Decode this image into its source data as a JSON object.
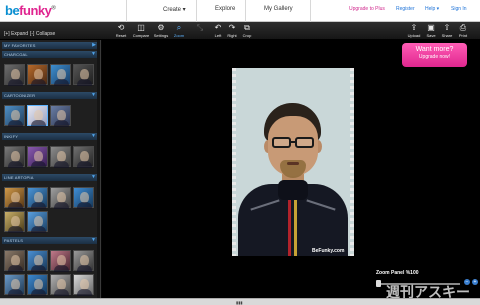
{
  "app": {
    "logo_be": "be",
    "logo_funky": "funky",
    "logo_mark": "®"
  },
  "topnav": {
    "create": "Create ▾",
    "explore": "Explore",
    "gallery": "My Gallery",
    "upgrade": "Upgrade to Plus",
    "register": "Register",
    "help": "Help ▾",
    "signin": "Sign In"
  },
  "toolbar": {
    "expand": "[+] Expand",
    "collapse": "[-] Collapse",
    "tools": [
      {
        "label": "Reset",
        "icon": "⟲"
      },
      {
        "label": "Compare",
        "icon": "◫"
      },
      {
        "label": "Settings",
        "icon": "⚙"
      },
      {
        "label": "Zoom",
        "icon": "⌕"
      },
      {
        "label": "",
        "icon": "⤡"
      },
      {
        "label": "Left",
        "icon": "↶"
      },
      {
        "label": "Right",
        "icon": "↷"
      },
      {
        "label": "Crop",
        "icon": "⧉"
      }
    ],
    "right_tools": [
      {
        "label": "Upload",
        "icon": "⇪"
      },
      {
        "label": "Save",
        "icon": "▣"
      },
      {
        "label": "Share",
        "icon": "⇧"
      },
      {
        "label": "Print",
        "icon": "⎙"
      }
    ]
  },
  "sidebar": {
    "categories": [
      {
        "name": "MY FAVORITES"
      },
      {
        "name": "CHARCOAL"
      },
      {
        "name": "CARTOONIZER"
      },
      {
        "name": "INKIFY"
      },
      {
        "name": "LINE ARTOPIA"
      },
      {
        "name": "PASTELS"
      }
    ]
  },
  "promo": {
    "line1": "Want more?",
    "line2": "Upgrade now!"
  },
  "photo": {
    "watermark": "BeFunky.com"
  },
  "zoom": {
    "title": "Zoom Panel %100",
    "minus": "−",
    "plus": "+"
  },
  "overlay": {
    "brand": "週刊アスキー"
  },
  "bottom": {
    "handle": "▮▮▮"
  }
}
